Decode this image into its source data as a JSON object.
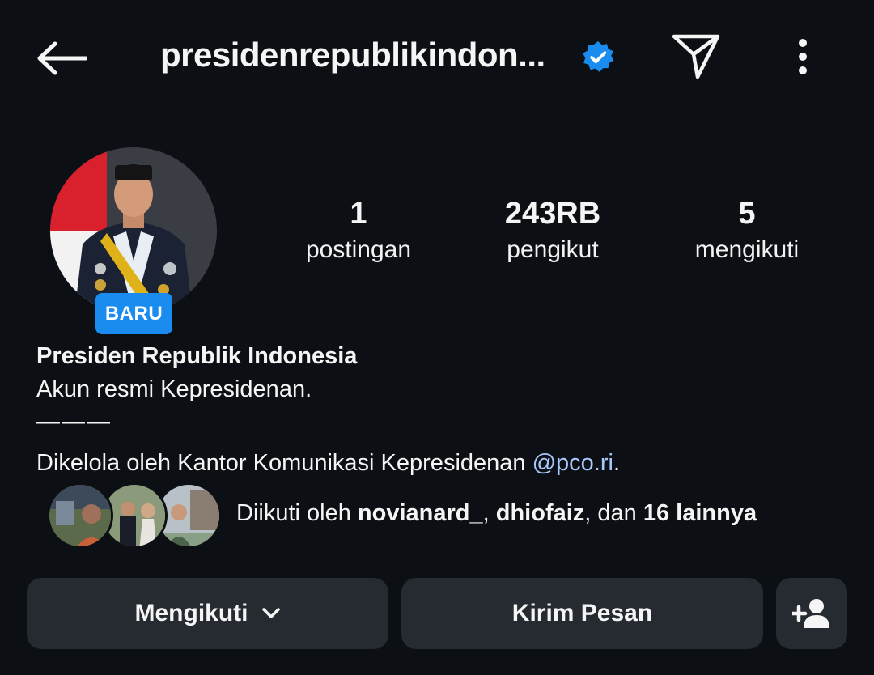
{
  "header": {
    "username": "presidenrepublikindon...",
    "verified_icon": "verified-badge-icon",
    "back_icon": "arrow-left-icon",
    "share_icon": "paper-plane-icon",
    "more_icon": "more-vertical-icon"
  },
  "profile": {
    "new_badge": "BARU",
    "stats": {
      "posts": {
        "value": "1",
        "label": "postingan"
      },
      "followers": {
        "value": "243RB",
        "label": "pengikut"
      },
      "following": {
        "value": "5",
        "label": "mengikuti"
      }
    },
    "bio": {
      "name": "Presiden Republik Indonesia",
      "line1": "Akun resmi Kepresidenan.",
      "separator": "———",
      "managed_prefix": "Dikelola oleh Kantor Komunikasi Kepresidenan ",
      "managed_mention": "@pco.ri",
      "managed_suffix": "."
    },
    "followed_by": {
      "prefix": "Diikuti oleh ",
      "user1": "novianard_",
      "comma": ", ",
      "user2": "dhiofaiz",
      "middle": ", dan ",
      "others": "16 lainnya"
    }
  },
  "actions": {
    "following_label": "Mengikuti",
    "message_label": "Kirim Pesan",
    "add_icon": "person-add-icon"
  },
  "colors": {
    "background": "#0c0f14",
    "button": "#262a31",
    "accent_blue": "#1a8cf0",
    "mention": "#a8c7fa"
  }
}
